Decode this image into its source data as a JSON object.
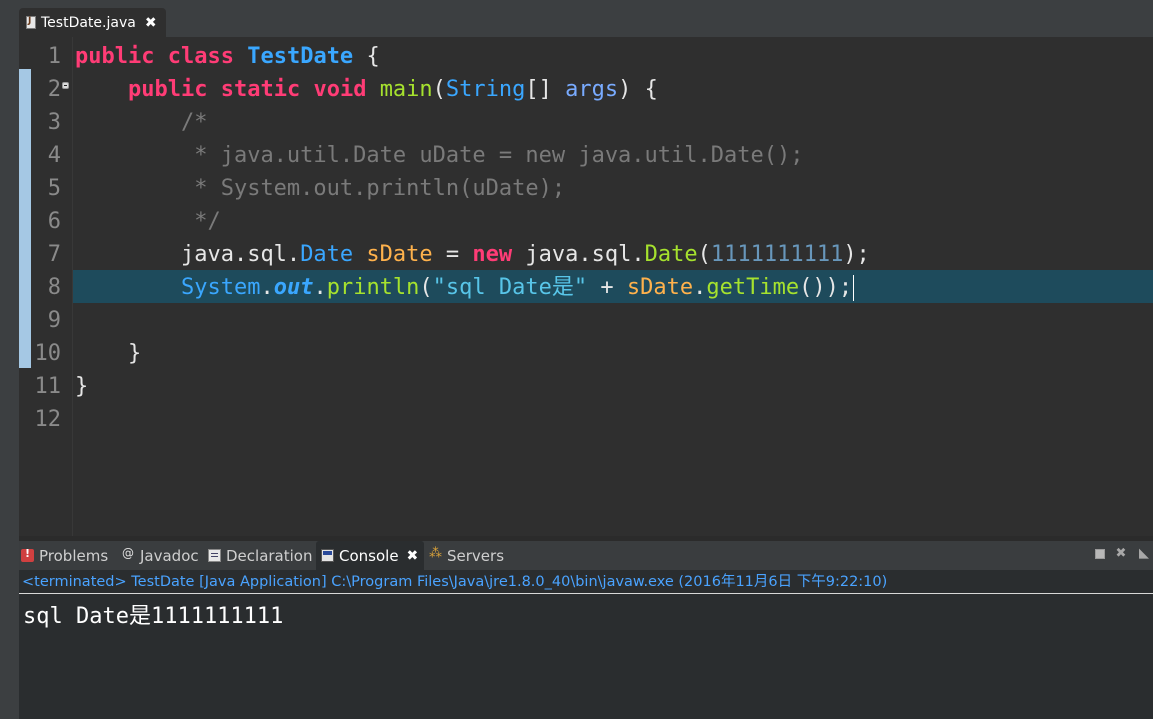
{
  "editor_tab": {
    "label": "TestDate.java",
    "close": "✖"
  },
  "line_numbers": [
    "1",
    "2",
    "3",
    "4",
    "5",
    "6",
    "7",
    "8",
    "9",
    "10",
    "11",
    "12"
  ],
  "code": {
    "l1": {
      "t1": "public",
      "t2": "class",
      "t3": "TestDate",
      "t4": "{"
    },
    "l2": {
      "t1": "public",
      "t2": "static",
      "t3": "void",
      "t4": "main",
      "t5": "(",
      "t6": "String",
      "t7": "[] ",
      "t8": "args",
      "t9": ") {"
    },
    "l3": "/*",
    "l4": " * java.util.Date uDate = new java.util.Date();",
    "l5": " * System.out.println(uDate);",
    "l6": " */",
    "l7": {
      "t1": "java.sql.",
      "t2": "Date",
      "t3": "sDate",
      "t4": "=",
      "t5": "new",
      "t6": "java.sql.",
      "t7": "Date",
      "t8": "(",
      "t9": "1111111111",
      "t10": ");"
    },
    "l8": {
      "t1": "System",
      "t2": ".",
      "t3": "out",
      "t4": ".",
      "t5": "println",
      "t6": "(",
      "t7": "\"sql Date是\"",
      "t8": "+",
      "t9": "sDate",
      "t10": ".",
      "t11": "getTime",
      "t12": "());"
    },
    "l10": "}",
    "l11": "}"
  },
  "view_tabs": {
    "problems": "Problems",
    "javadoc": "Javadoc",
    "declaration": "Declaration",
    "console": "Console",
    "servers": "Servers",
    "console_close": "✖"
  },
  "view_controls": {
    "close": "✖"
  },
  "console": {
    "header": "<terminated> TestDate [Java Application] C:\\Program Files\\Java\\jre1.8.0_40\\bin\\javaw.exe (2016年11月6日 下午9:22:10)",
    "output": "sql Date是1111111111"
  },
  "colors": {
    "keyword": "#ff3c76",
    "class": "#3aa7ff",
    "method": "#a6e22e",
    "comment": "#7a7a7a",
    "number": "#6897bb",
    "local_var": "#ffb24c",
    "current_line": "#1e4b5c",
    "console_header": "#4aa3ff"
  },
  "icons": [
    "java-file-icon",
    "problems-icon",
    "javadoc-icon",
    "declaration-icon",
    "console-icon",
    "servers-icon",
    "minimize-icon",
    "maximize-icon",
    "close-icon"
  ]
}
